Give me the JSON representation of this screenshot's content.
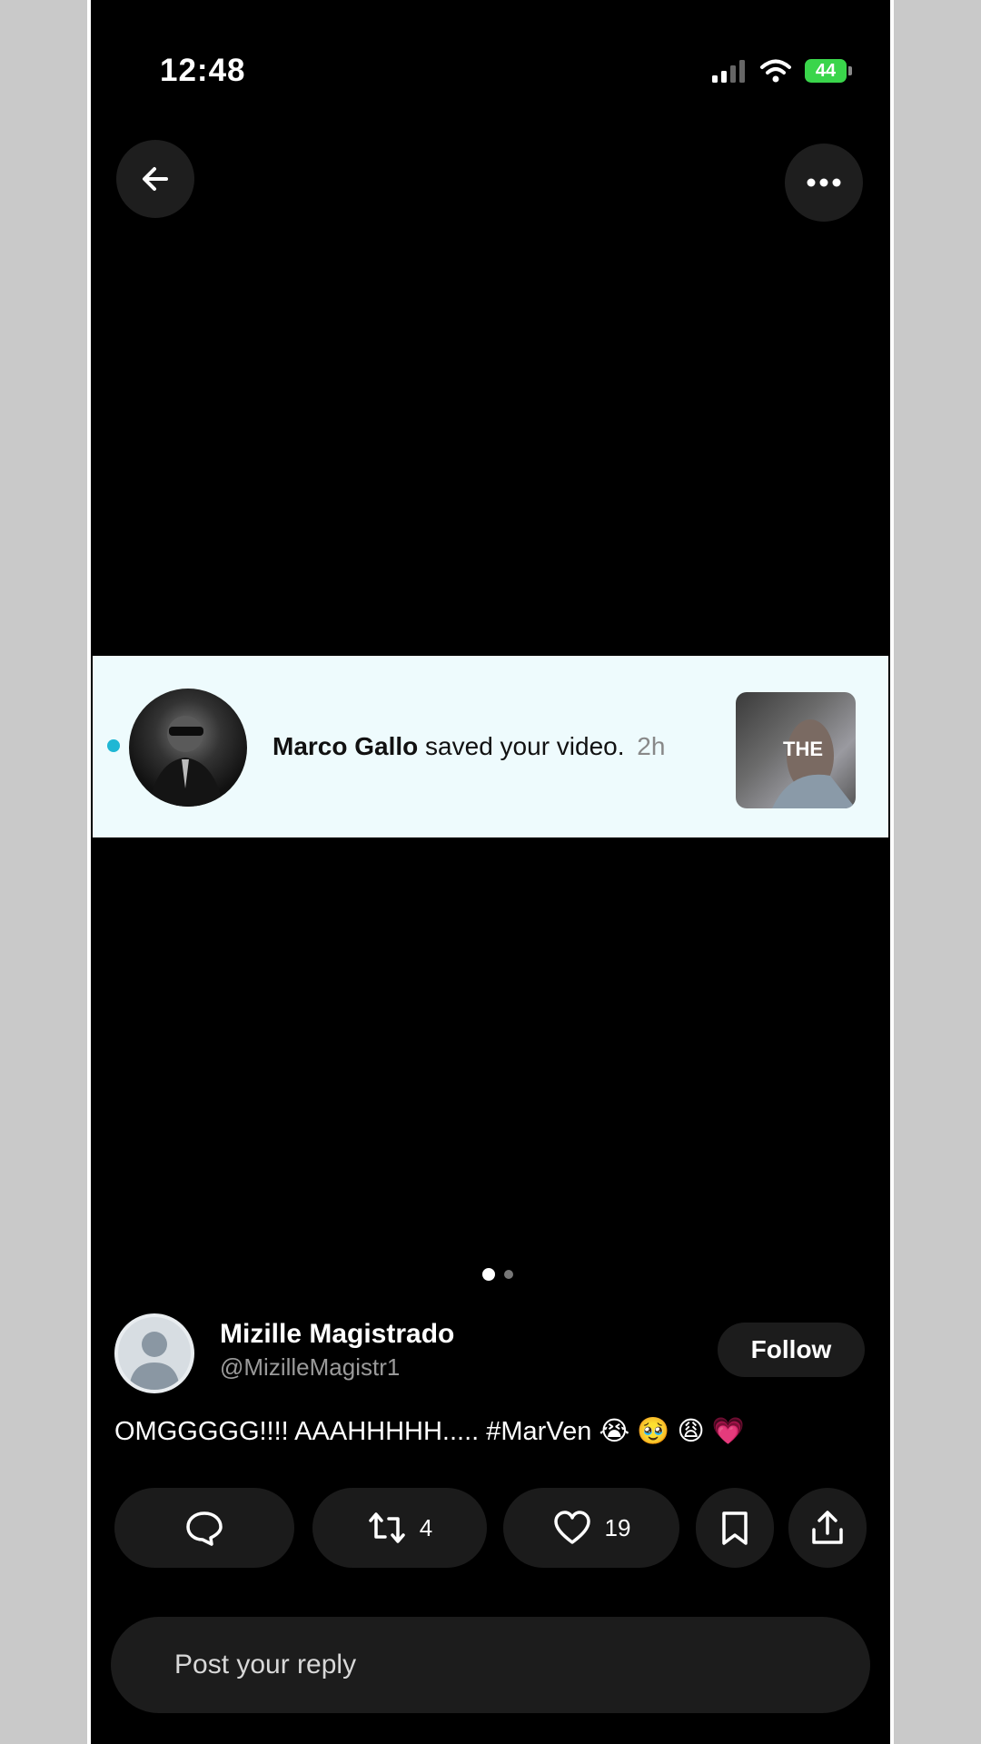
{
  "status_bar": {
    "time": "12:48",
    "battery": "44",
    "icons": [
      "signal-icon",
      "wifi-icon",
      "battery-icon"
    ]
  },
  "top_bar": {
    "back_icon": "arrow-left-icon",
    "more_icon": "more-horizontal-icon"
  },
  "notification": {
    "name": "Marco Gallo",
    "message": "saved your video.",
    "time": "2h",
    "thumbnail_text": "THE",
    "unread_color": "#1fb7d4"
  },
  "pager": {
    "count": 2,
    "active": 1
  },
  "post": {
    "author_name": "Mizille Magistrado",
    "author_handle": "@MizilleMagistr1",
    "follow_label": "Follow",
    "text": "OMGGGGG!!!! AAAHHHHH..... #MarVen 😭 🥹 😩 💗"
  },
  "actions": {
    "reply_icon": "comment-icon",
    "repost_icon": "repost-icon",
    "repost_count": "4",
    "like_icon": "heart-icon",
    "like_count": "19",
    "bookmark_icon": "bookmark-icon",
    "share_icon": "share-icon"
  },
  "reply": {
    "placeholder": "Post your reply"
  }
}
